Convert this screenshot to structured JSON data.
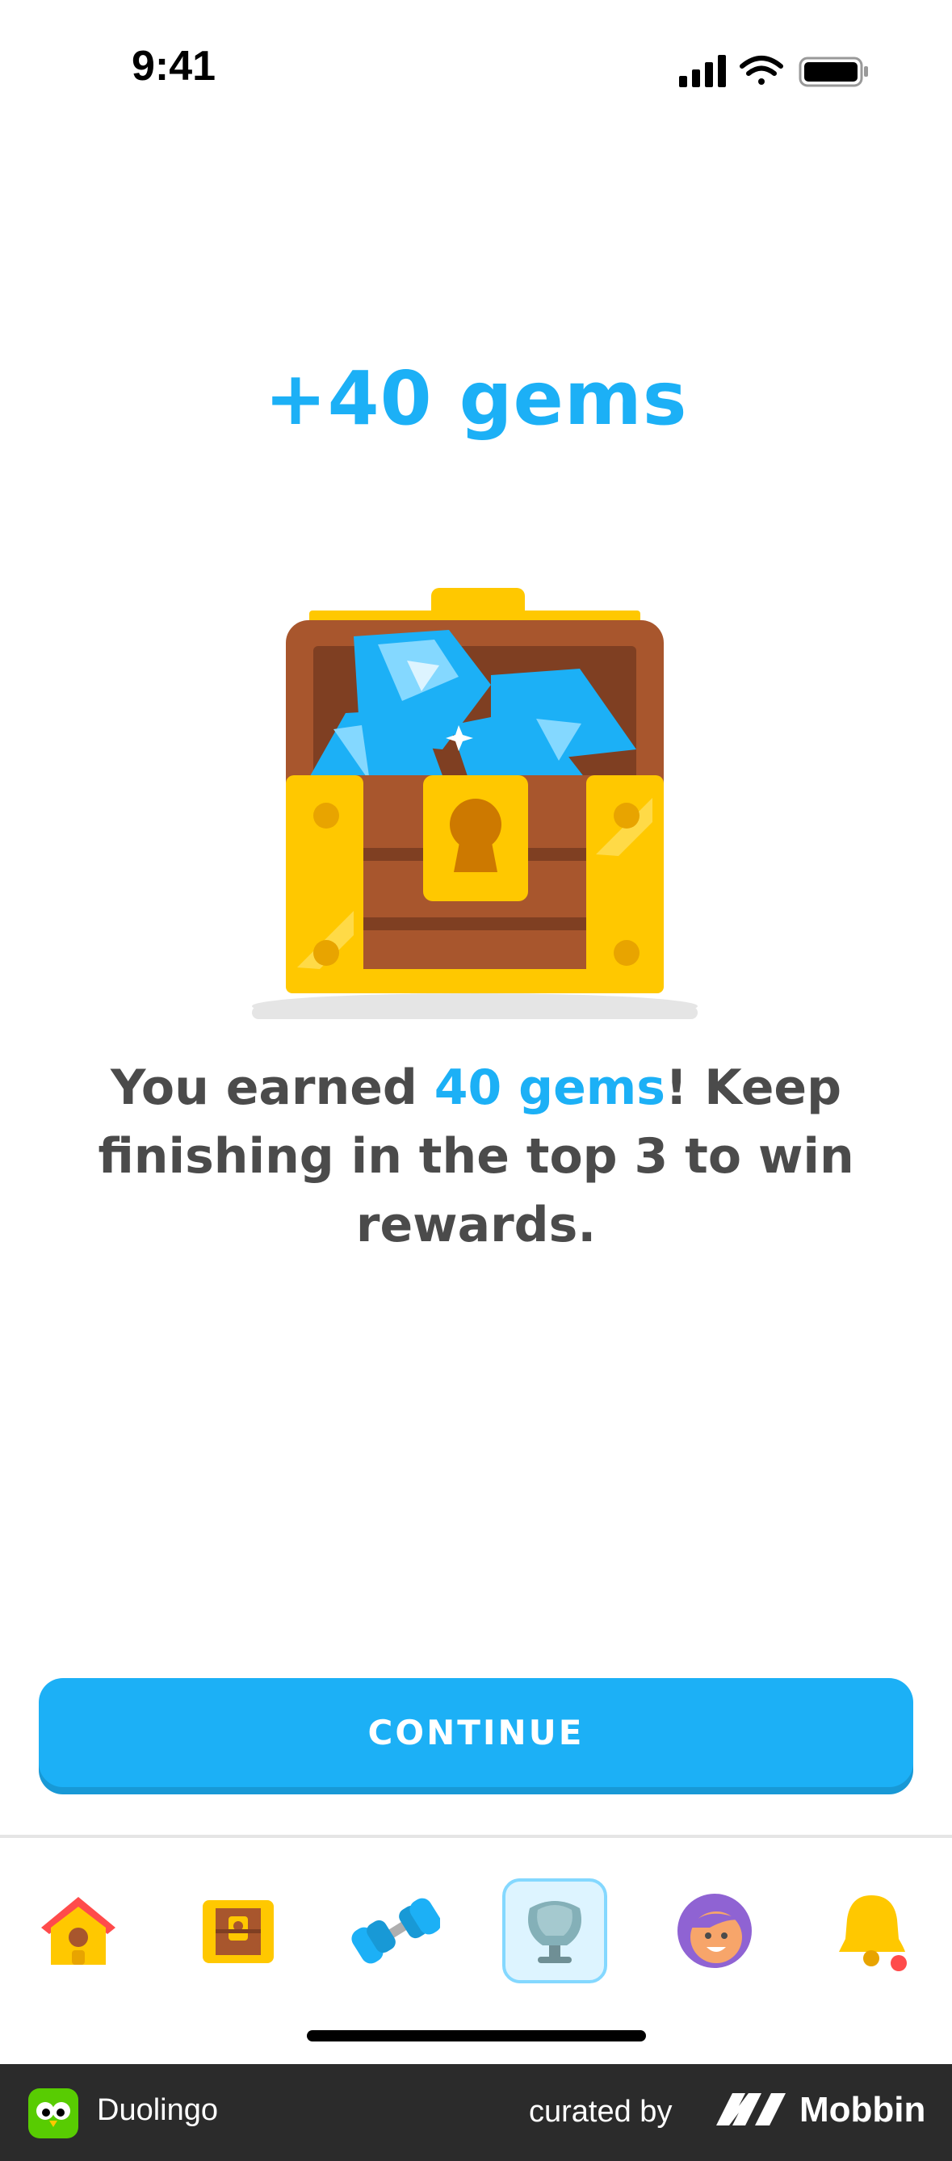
{
  "status_bar": {
    "time": "9:41"
  },
  "reward": {
    "title": "+40 gems"
  },
  "message": {
    "before": "You earned ",
    "highlight": "40 gems",
    "after": "! Keep finishing in the top 3 to win rewards."
  },
  "continue_button": {
    "label": "CONTINUE"
  },
  "colors": {
    "accent": "#1cb0f6",
    "text": "#4b4b4b",
    "active_tab_bg": "#ddf4ff"
  },
  "tab_bar": {
    "tabs": [
      {
        "name": "home",
        "icon": "house-icon",
        "active": false
      },
      {
        "name": "chest",
        "icon": "treasure-chest-icon",
        "active": false
      },
      {
        "name": "practice",
        "icon": "dumbbell-icon",
        "active": false
      },
      {
        "name": "leaderboard",
        "icon": "trophy-icon",
        "active": true
      },
      {
        "name": "profile",
        "icon": "avatar-icon",
        "active": false
      },
      {
        "name": "notifications",
        "icon": "bell-icon",
        "active": false,
        "has_badge": true
      }
    ]
  },
  "footer": {
    "app_name": "Duolingo",
    "curated_by": "curated by",
    "brand": "Mobbin"
  }
}
